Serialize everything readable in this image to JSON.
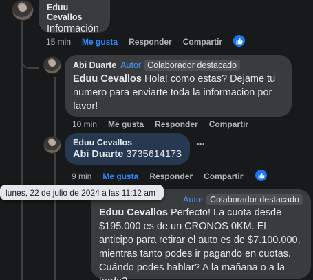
{
  "comment1": {
    "author": "Eduu Cevallos",
    "text": "Información",
    "time": "15 min",
    "like_label": "Me gusta",
    "reply_label": "Responder",
    "share_label": "Compartir"
  },
  "comment2": {
    "author": "Abi Duarte",
    "badge_author": "Autor",
    "badge_collab": "Colaborador destacado",
    "mention": "Eduu Cevallos",
    "text": " Hola! como estas? Dejame tu numero para enviarte toda la informacion por favor!",
    "time": "10 min",
    "like_label": "Me gusta",
    "reply_label": "Responder",
    "share_label": "Compartir"
  },
  "comment3": {
    "author": "Eduu Cevallos",
    "mention": "Abi Duarte",
    "text": " 3735614173",
    "more": "•••",
    "time": "9 min",
    "like_label": "Me gusta",
    "reply_label": "Responder",
    "share_label": "Compartir"
  },
  "tooltip": {
    "text": "lunes, 22 de julio de 2024 a las 11:12 am"
  },
  "comment4": {
    "badge_author": "Autor",
    "badge_collab": "Colaborador destacado",
    "mention": "Eduu Cevallos",
    "text": " Perfecto! La cuota desde $195.000 es de un CRONOS 0KM. El anticipo para retirar el auto es de $7.100.000, mientras tanto podes ir pagando en cuotas. Cuándo podes hablar? A la mañana o a la tarde?"
  },
  "colors": {
    "background": "#18191a",
    "bubble": "#3a3b3c",
    "bubble_highlight": "#263951",
    "accent": "#2d88ff",
    "muted": "#b0b3b8"
  },
  "icons": {
    "like": "thumbs-up-icon",
    "more": "more-options-icon"
  }
}
